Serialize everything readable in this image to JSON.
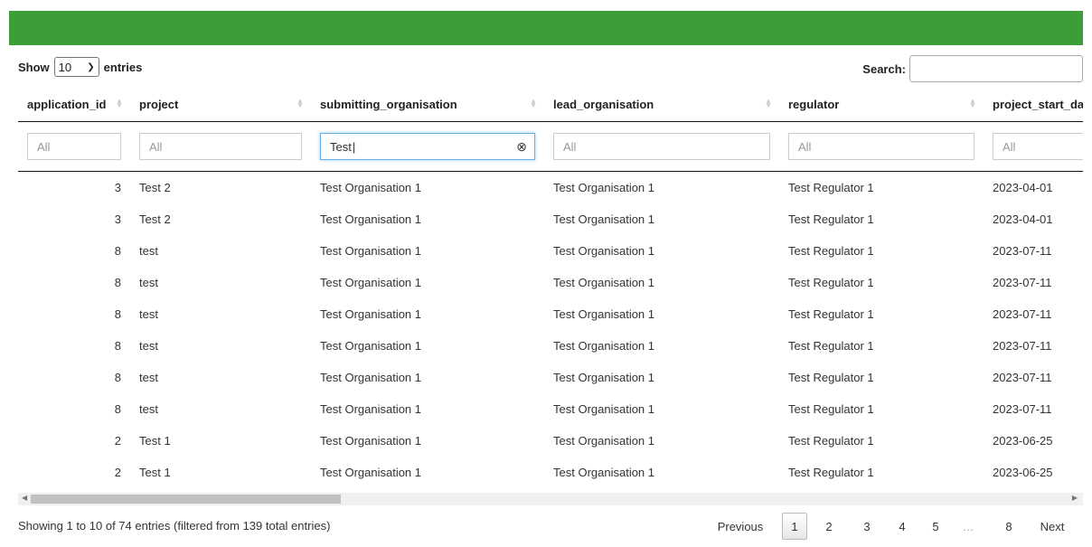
{
  "colors": {
    "header_bar": "#3c9e36"
  },
  "length_control": {
    "prefix": "Show",
    "value": "10",
    "suffix": "entries"
  },
  "search": {
    "label": "Search:",
    "value": ""
  },
  "columns": [
    "application_id",
    "project",
    "submitting_organisation",
    "lead_organisation",
    "regulator",
    "project_start_date"
  ],
  "filters": [
    "All",
    "All",
    "Test",
    "All",
    "All",
    "All"
  ],
  "rows": [
    [
      "3",
      "Test 2",
      "Test Organisation 1",
      "Test Organisation 1",
      "Test Regulator 1",
      "2023-04-01"
    ],
    [
      "3",
      "Test 2",
      "Test Organisation 1",
      "Test Organisation 1",
      "Test Regulator 1",
      "2023-04-01"
    ],
    [
      "8",
      "test",
      "Test Organisation 1",
      "Test Organisation 1",
      "Test Regulator 1",
      "2023-07-11"
    ],
    [
      "8",
      "test",
      "Test Organisation 1",
      "Test Organisation 1",
      "Test Regulator 1",
      "2023-07-11"
    ],
    [
      "8",
      "test",
      "Test Organisation 1",
      "Test Organisation 1",
      "Test Regulator 1",
      "2023-07-11"
    ],
    [
      "8",
      "test",
      "Test Organisation 1",
      "Test Organisation 1",
      "Test Regulator 1",
      "2023-07-11"
    ],
    [
      "8",
      "test",
      "Test Organisation 1",
      "Test Organisation 1",
      "Test Regulator 1",
      "2023-07-11"
    ],
    [
      "8",
      "test",
      "Test Organisation 1",
      "Test Organisation 1",
      "Test Regulator 1",
      "2023-07-11"
    ],
    [
      "2",
      "Test 1",
      "Test Organisation 1",
      "Test Organisation 1",
      "Test Regulator 1",
      "2023-06-25"
    ],
    [
      "2",
      "Test 1",
      "Test Organisation 1",
      "Test Organisation 1",
      "Test Regulator 1",
      "2023-06-25"
    ]
  ],
  "info": "Showing 1 to 10 of 74 entries (filtered from 139 total entries)",
  "pagination": {
    "previous": "Previous",
    "pages": [
      "1",
      "2",
      "3",
      "4",
      "5",
      "…",
      "8"
    ],
    "current": "1",
    "next": "Next"
  }
}
